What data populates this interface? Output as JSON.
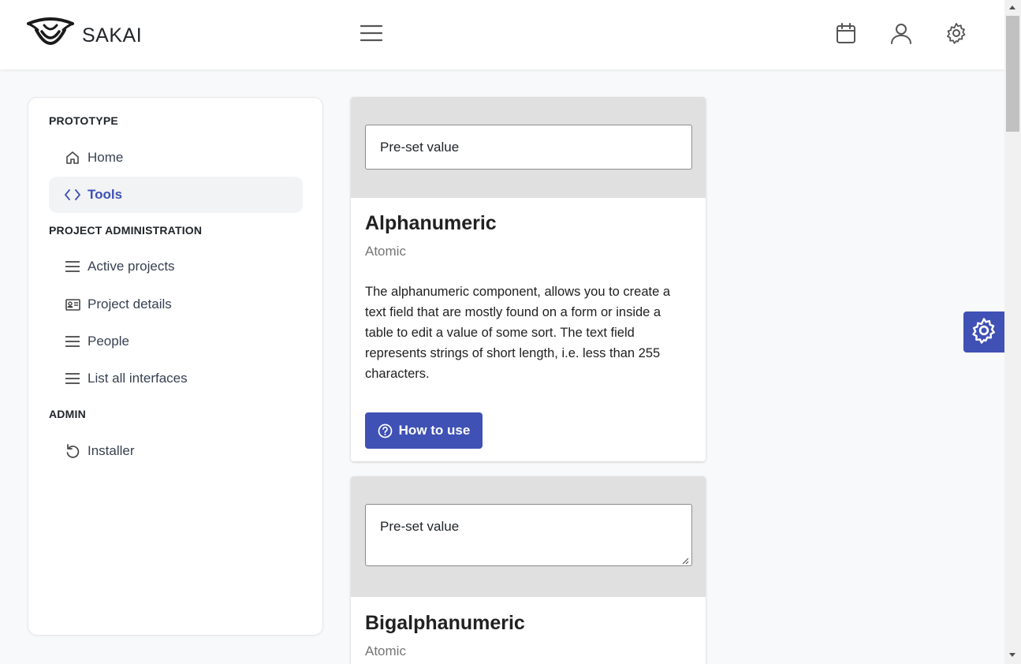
{
  "header": {
    "brand": "SAKAI",
    "menu_icon": "hamburger-icon",
    "actions": [
      "calendar-icon",
      "user-icon",
      "gear-icon"
    ]
  },
  "sidebar": {
    "sections": [
      {
        "label": "PROTOTYPE",
        "items": [
          {
            "label": "Home",
            "icon": "home-icon"
          },
          {
            "label": "Tools",
            "icon": "code-icon",
            "active": true
          }
        ]
      },
      {
        "label": "PROJECT ADMINISTRATION",
        "items": [
          {
            "label": "Active projects",
            "icon": "bars-icon"
          },
          {
            "label": "Project details",
            "icon": "id-card-icon"
          },
          {
            "label": "People",
            "icon": "bars-icon"
          },
          {
            "label": "List all interfaces",
            "icon": "bars-icon"
          }
        ]
      },
      {
        "label": "ADMIN",
        "items": [
          {
            "label": "Installer",
            "icon": "refresh-icon"
          }
        ]
      }
    ]
  },
  "cards": [
    {
      "input_value": "Pre-set value",
      "title": "Alphanumeric",
      "subtitle": "Atomic",
      "description": "The alphanumeric component, allows you to create a text field that are mostly found on a form or inside a table to edit a value of some sort. The text field represents strings of short length, i.e. less than 255 characters.",
      "button_label": "How to use"
    },
    {
      "input_value": "Pre-set value",
      "title": "Bigalphanumeric",
      "subtitle": "Atomic"
    }
  ],
  "colors": {
    "accent": "#3f51b5",
    "card_header": "#e0e0e0",
    "background": "#f8f9fa"
  }
}
